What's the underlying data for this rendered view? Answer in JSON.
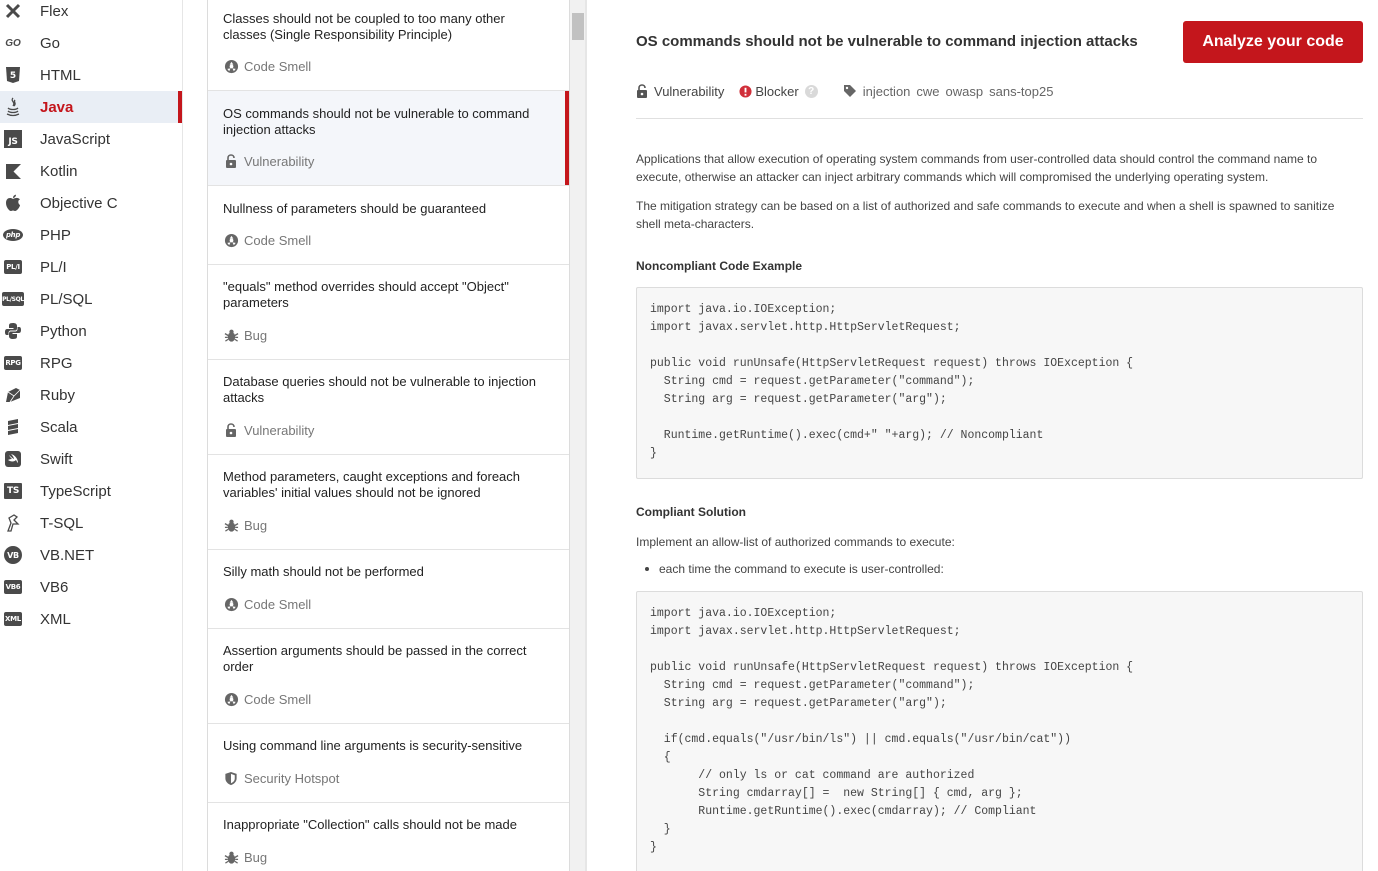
{
  "languages": [
    {
      "label": "Flex",
      "icon": "flex-icon"
    },
    {
      "label": "Go",
      "icon": "go-icon"
    },
    {
      "label": "HTML",
      "icon": "html5-icon"
    },
    {
      "label": "Java",
      "icon": "java-icon",
      "active": true
    },
    {
      "label": "JavaScript",
      "icon": "javascript-icon"
    },
    {
      "label": "Kotlin",
      "icon": "kotlin-icon"
    },
    {
      "label": "Objective C",
      "icon": "apple-icon"
    },
    {
      "label": "PHP",
      "icon": "php-icon"
    },
    {
      "label": "PL/I",
      "icon": "pli-icon"
    },
    {
      "label": "PL/SQL",
      "icon": "plsql-icon"
    },
    {
      "label": "Python",
      "icon": "python-icon"
    },
    {
      "label": "RPG",
      "icon": "rpg-icon"
    },
    {
      "label": "Ruby",
      "icon": "ruby-icon"
    },
    {
      "label": "Scala",
      "icon": "scala-icon"
    },
    {
      "label": "Swift",
      "icon": "swift-icon"
    },
    {
      "label": "TypeScript",
      "icon": "typescript-icon"
    },
    {
      "label": "T-SQL",
      "icon": "tsql-icon"
    },
    {
      "label": "VB.NET",
      "icon": "vbnet-icon"
    },
    {
      "label": "VB6",
      "icon": "vb6-icon"
    },
    {
      "label": "XML",
      "icon": "xml-icon"
    }
  ],
  "icon_text": {
    "go": "GO",
    "html": "5",
    "js": "JS",
    "php": "php",
    "pli": "PL/I",
    "plsql": "PL/SQL",
    "rpg": "RPG",
    "ts": "TS",
    "vbnet": "VB",
    "vb6": "VB6",
    "xml": "XML"
  },
  "rules": [
    {
      "title": "Classes should not be coupled to too many other classes (Single Responsibility Principle)",
      "type": "Code Smell",
      "icon": "code-smell-icon"
    },
    {
      "title": "OS commands should not be vulnerable to command injection attacks",
      "type": "Vulnerability",
      "icon": "lock-icon",
      "active": true
    },
    {
      "title": "Nullness of parameters should be guaranteed",
      "type": "Code Smell",
      "icon": "code-smell-icon"
    },
    {
      "title": "\"equals\" method overrides should accept \"Object\" parameters",
      "type": "Bug",
      "icon": "bug-icon"
    },
    {
      "title": "Database queries should not be vulnerable to injection attacks",
      "type": "Vulnerability",
      "icon": "lock-icon"
    },
    {
      "title": "Method parameters, caught exceptions and foreach variables' initial values should not be ignored",
      "type": "Bug",
      "icon": "bug-icon"
    },
    {
      "title": "Silly math should not be performed",
      "type": "Code Smell",
      "icon": "code-smell-icon"
    },
    {
      "title": "Assertion arguments should be passed in the correct order",
      "type": "Code Smell",
      "icon": "code-smell-icon"
    },
    {
      "title": "Using command line arguments is security-sensitive",
      "type": "Security Hotspot",
      "icon": "shield-icon"
    },
    {
      "title": "Inappropriate \"Collection\" calls should not be made",
      "type": "Bug",
      "icon": "bug-icon"
    }
  ],
  "detail": {
    "title": "OS commands should not be vulnerable to command injection attacks",
    "analyze_label": "Analyze your code",
    "type": "Vulnerability",
    "severity": "Blocker",
    "help": "?",
    "tags": [
      "injection",
      "cwe",
      "owasp",
      "sans-top25"
    ],
    "paragraph1": "Applications that allow execution of operating system commands from user-controlled data should control the command name to execute, otherwise an attacker can inject arbitrary commands which will compromised the underlying operating system.",
    "paragraph2": "The mitigation strategy can be based on a list of authorized and safe commands to execute and when a shell is spawned to sanitize shell meta-characters.",
    "noncompliant_heading": "Noncompliant Code Example",
    "noncompliant_code": "import java.io.IOException;\nimport javax.servlet.http.HttpServletRequest;\n\npublic void runUnsafe(HttpServletRequest request) throws IOException {\n  String cmd = request.getParameter(\"command\");\n  String arg = request.getParameter(\"arg\");\n\n  Runtime.getRuntime().exec(cmd+\" \"+arg); // Noncompliant\n}",
    "compliant_heading": "Compliant Solution",
    "compliant_intro": "Implement an allow-list of authorized commands to execute:",
    "compliant_bullet": "each time the command to execute is user-controlled:",
    "compliant_code": "import java.io.IOException;\nimport javax.servlet.http.HttpServletRequest;\n\npublic void runUnsafe(HttpServletRequest request) throws IOException {\n  String cmd = request.getParameter(\"command\");\n  String arg = request.getParameter(\"arg\");\n\n  if(cmd.equals(\"/usr/bin/ls\") || cmd.equals(\"/usr/bin/cat\"))\n  {\n       // only ls or cat command are authorized\n       String cmdarray[] =  new String[] { cmd, arg };\n       Runtime.getRuntime().exec(cmdarray); // Compliant\n  }\n}"
  },
  "colors": {
    "accent": "#c4161c",
    "active_bg": "#e9eef5",
    "blocker": "#d02f3a"
  }
}
